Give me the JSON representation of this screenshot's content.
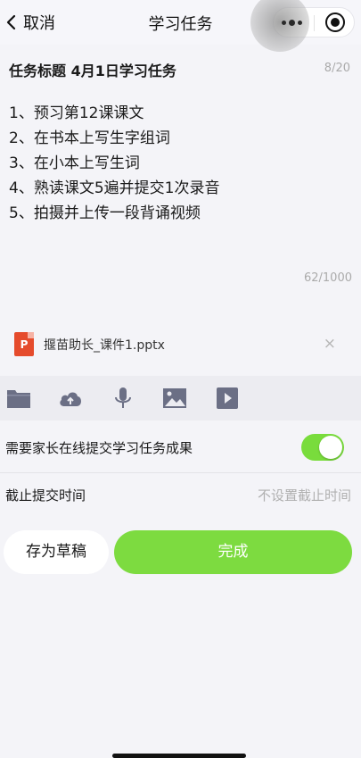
{
  "navbar": {
    "back_label": "取消",
    "title": "学习任务",
    "icons": {
      "back": "chevron-left-icon",
      "more": "more-dots-icon",
      "target": "target-icon"
    }
  },
  "task": {
    "title_label": "任务标题",
    "title_value": "4月1日学习任务",
    "title_counter": "8/20",
    "items": [
      "1、预习第12课课文",
      "2、在书本上写生字组词",
      "3、在小本上写生词",
      "4、熟读课文5遍并提交1次录音",
      "5、拍摄并上传一段背诵视频"
    ],
    "content_counter": "62/1000"
  },
  "attachment": {
    "icon_letter": "P",
    "name": "揠苗助长_课件1.pptx",
    "remove_symbol": "×"
  },
  "toolbar": {
    "icons": [
      "folder-icon",
      "cloud-upload-icon",
      "microphone-icon",
      "image-icon",
      "video-play-icon"
    ],
    "color": "#6b6f85"
  },
  "settings": {
    "parent_submit_label": "需要家长在线提交学习任务成果",
    "parent_submit_enabled": true,
    "deadline_label": "截止提交时间",
    "deadline_value": "不设置截止时间"
  },
  "actions": {
    "draft_label": "存为草稿",
    "done_label": "完成"
  },
  "colors": {
    "accent": "#7ddb40",
    "toggle_on": "#79dc3c",
    "ppt": "#e54b2c",
    "muted_text": "#b0b0b0"
  }
}
